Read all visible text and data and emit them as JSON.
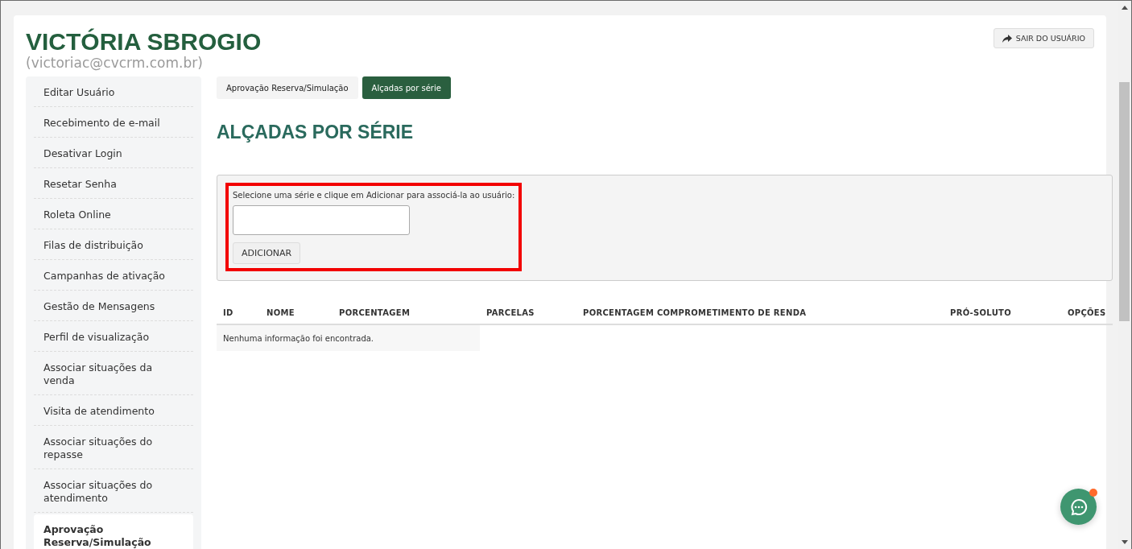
{
  "user": {
    "name": "VICTÓRIA SBROGIO",
    "email": "(victoriac@cvcrm.com.br)"
  },
  "logout_button": {
    "label": "SAIR DO USUÁRIO"
  },
  "sidebar": {
    "items": [
      {
        "label": "Editar Usuário",
        "selected": false
      },
      {
        "label": "Recebimento de e-mail",
        "selected": false
      },
      {
        "label": "Desativar Login",
        "selected": false
      },
      {
        "label": "Resetar Senha",
        "selected": false
      },
      {
        "label": "Roleta Online",
        "selected": false
      },
      {
        "label": "Filas de distribuição",
        "selected": false
      },
      {
        "label": "Campanhas de ativação",
        "selected": false
      },
      {
        "label": "Gestão de Mensagens",
        "selected": false
      },
      {
        "label": "Perfil de visualização",
        "selected": false
      },
      {
        "label": "Associar situações da venda",
        "selected": false
      },
      {
        "label": "Visita de atendimento",
        "selected": false
      },
      {
        "label": "Associar situações do repasse",
        "selected": false
      },
      {
        "label": "Associar situações do atendimento",
        "selected": false
      },
      {
        "label": "Aprovação Reserva/Simulação",
        "selected": true
      }
    ]
  },
  "tabs": [
    {
      "label": "Aprovação Reserva/Simulação",
      "selected": false
    },
    {
      "label": "Alçadas por série",
      "selected": true
    }
  ],
  "page_title": "ALÇADAS POR SÉRIE",
  "form": {
    "instruction": "Selecione uma série e clique em Adicionar para associá-la ao usuário:",
    "add_button": "ADICIONAR",
    "highlighted": true
  },
  "table": {
    "columns": [
      "ID",
      "NOME",
      "PORCENTAGEM",
      "PARCELAS",
      "PORCENTAGEM COMPROMETIMENTO DE RENDA",
      "PRÓ-SOLUTO",
      "OPÇÕES"
    ],
    "empty_message": "Nenhuma informação foi encontrada."
  },
  "chat_button": {
    "notification": true
  }
}
